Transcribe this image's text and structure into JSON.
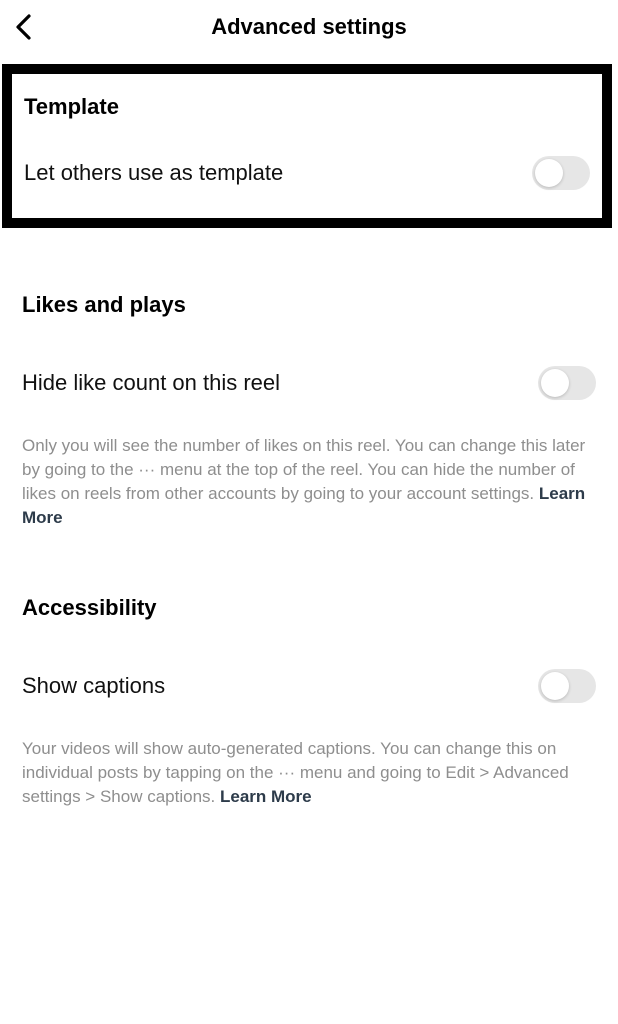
{
  "header": {
    "title": "Advanced settings"
  },
  "template_section": {
    "title": "Template",
    "row_label": "Let others use as template"
  },
  "likes_section": {
    "title": "Likes and plays",
    "row_label": "Hide like count on this reel",
    "help_text": "Only you will see the number of likes on this reel. You can change this later by going to the ··· menu at the top of the reel. You can hide the number of likes on reels from other accounts by going to your account settings. ",
    "learn_more": "Learn More"
  },
  "accessibility_section": {
    "title": "Accessibility",
    "row_label": "Show captions",
    "help_text": "Your videos will show auto-generated captions. You can change this on individual posts by tapping on the  ···  menu and going to Edit > Advanced settings > Show captions. ",
    "learn_more": "Learn More"
  }
}
